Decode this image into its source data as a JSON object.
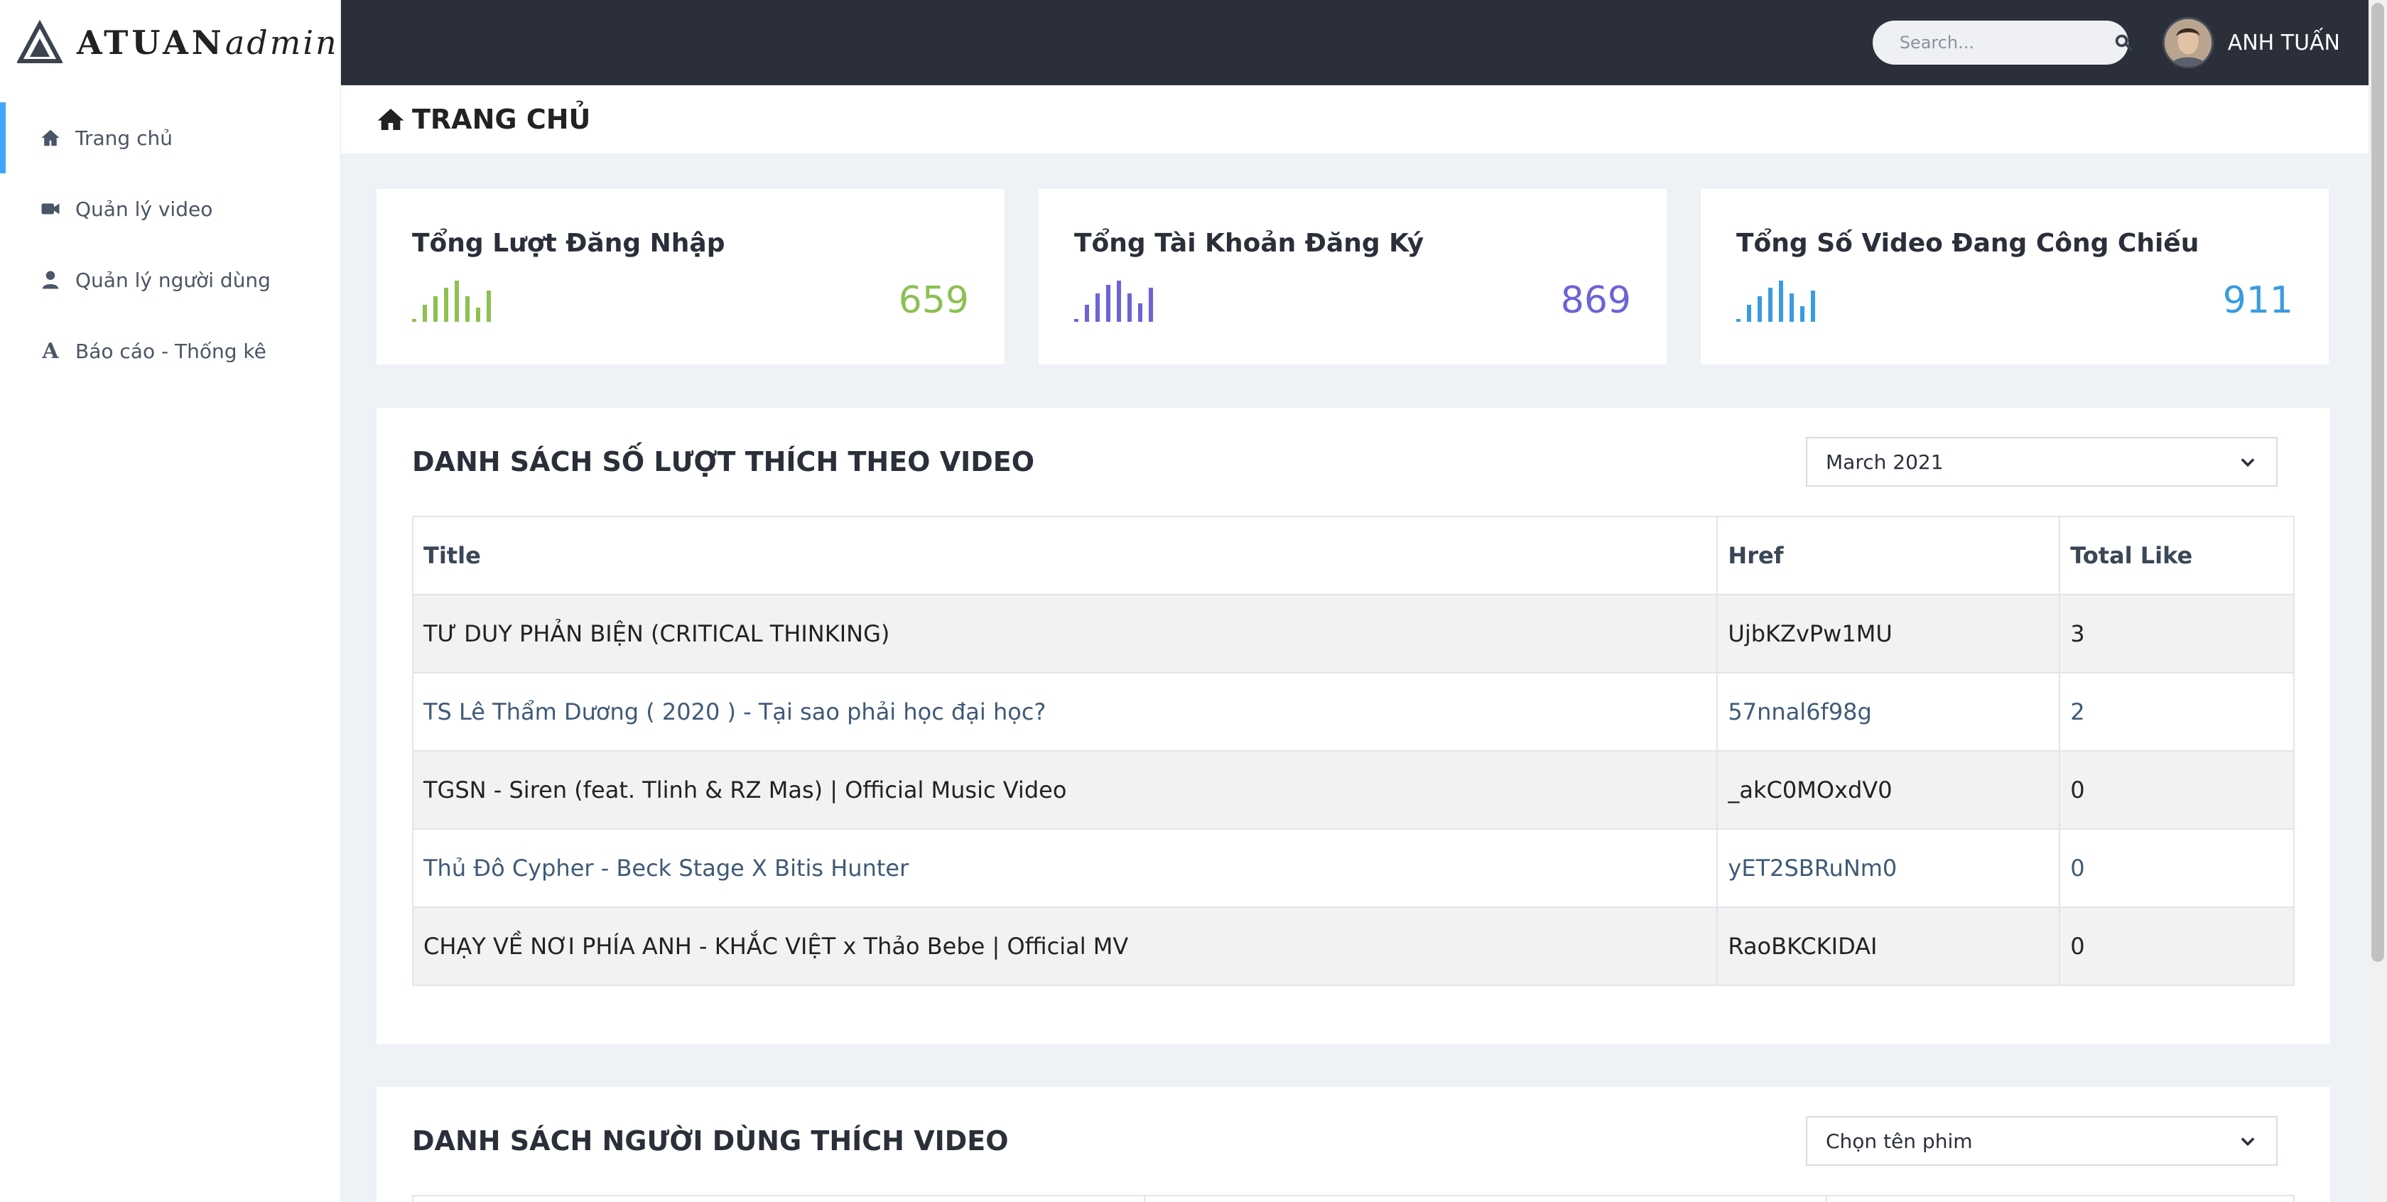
{
  "brand": {
    "name_bold": "ATUAN",
    "name_thin": "admin"
  },
  "sidebar": {
    "items": [
      {
        "label": "Trang chủ",
        "icon": "home-icon",
        "active": true
      },
      {
        "label": "Quản lý video",
        "icon": "video-icon",
        "active": false
      },
      {
        "label": "Quản lý người dùng",
        "icon": "user-icon",
        "active": false
      },
      {
        "label": "Báo cáo - Thống kê",
        "icon": "font-icon",
        "active": false
      }
    ]
  },
  "topbar": {
    "search_placeholder": "Search...",
    "user_name": "ANH TUẤN"
  },
  "page": {
    "title": "TRANG CHỦ"
  },
  "stats": [
    {
      "label": "Tổng Lượt Đăng Nhập",
      "value": "659",
      "color": "#8cc152"
    },
    {
      "label": "Tổng Tài Khoản Đăng Ký",
      "value": "869",
      "color": "#6c63d6"
    },
    {
      "label": "Tổng Số Video Đang Công Chiếu",
      "value": "911",
      "color": "#3a9be0"
    }
  ],
  "likes_panel": {
    "title": "DANH SÁCH SỐ LƯỢT THÍCH THEO VIDEO",
    "select_value": "March 2021",
    "columns": [
      "Title",
      "Href",
      "Total Like"
    ],
    "rows": [
      [
        "TƯ DUY PHẢN BIỆN (CRITICAL THINKING)",
        "UjbKZvPw1MU",
        "3"
      ],
      [
        "TS Lê Thẩm Dương ( 2020 ) - Tại sao phải học đại học?",
        "57nnal6f98g",
        "2"
      ],
      [
        "TGSN - Siren (feat. Tlinh & RZ Mas) | Official Music Video",
        "_akC0MOxdV0",
        "0"
      ],
      [
        "Thủ Đô Cypher - Beck Stage X Bitis Hunter",
        "yET2SBRuNm0",
        "0"
      ],
      [
        "CHẠY VỀ NƠI PHÍA ANH - KHẮC VIỆT x Thảo Bebe | Official MV",
        "RaoBKCKIDAI",
        "0"
      ]
    ]
  },
  "users_panel": {
    "title": "DANH SÁCH NGƯỜI DÙNG THÍCH VIDEO",
    "select_value": "Chọn tên phim"
  }
}
